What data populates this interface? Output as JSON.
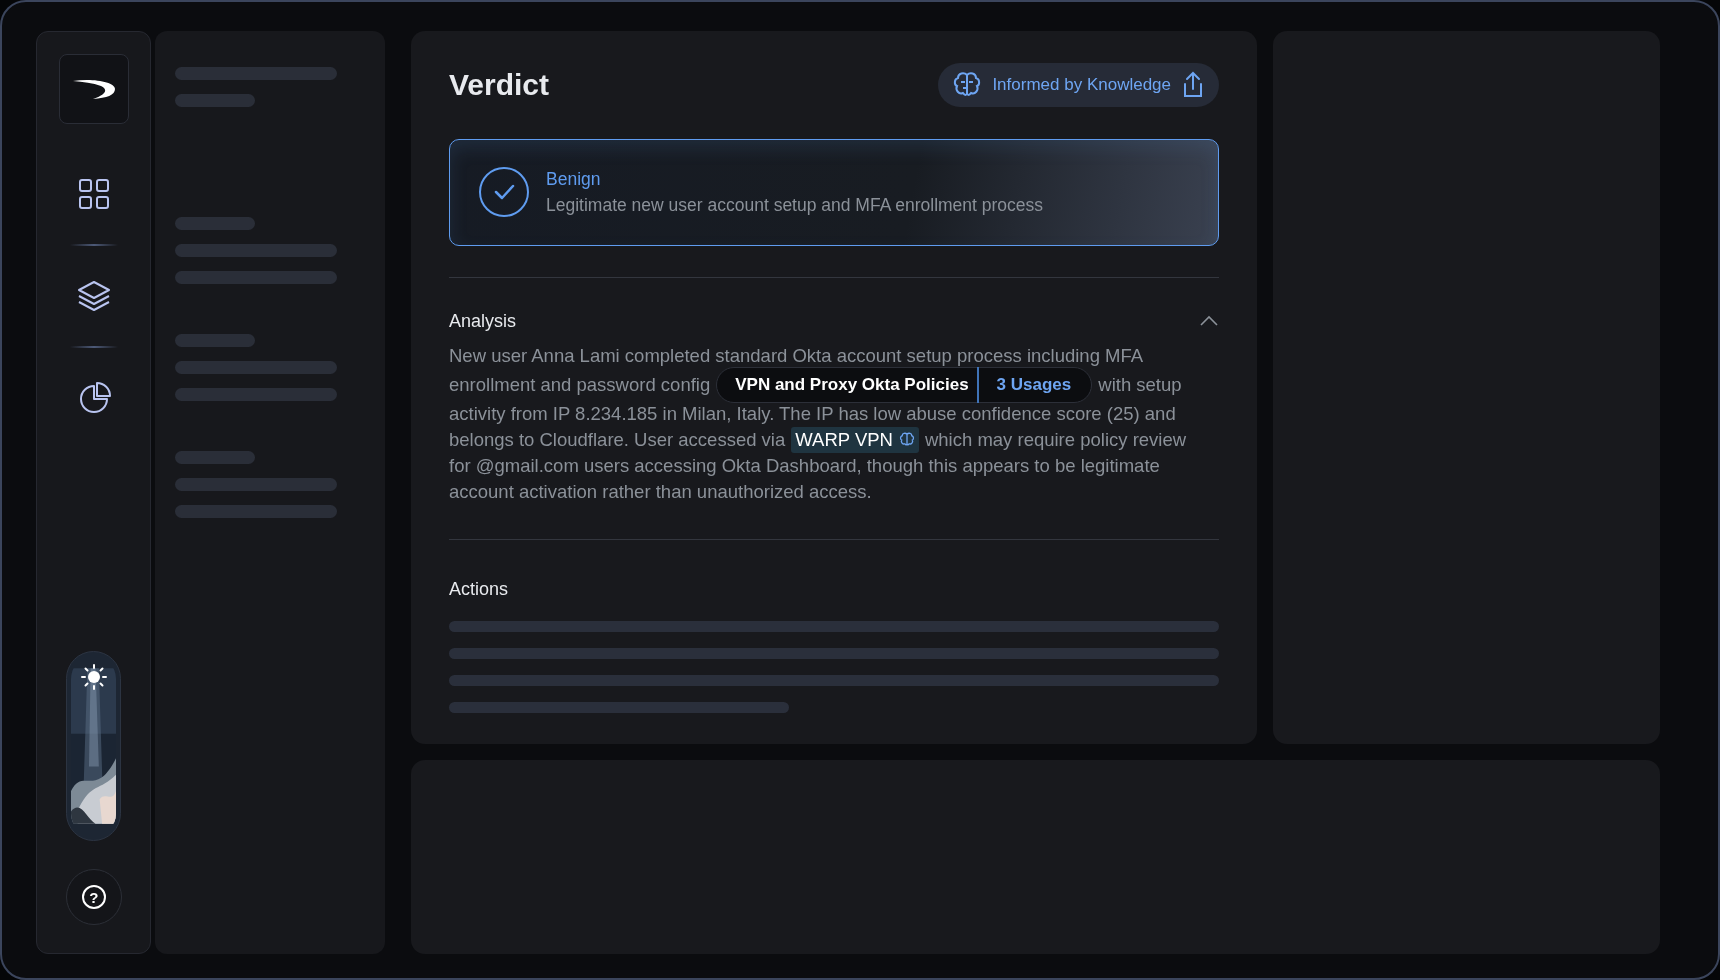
{
  "nav": [
    {
      "kind": "grid"
    },
    {
      "kind": "layers"
    },
    {
      "kind": "chart"
    }
  ],
  "help_button": {
    "label": "?"
  },
  "verdict": {
    "title": "Verdict",
    "knowledge_badge": "Informed by Knowledge",
    "result": {
      "kind": "benign",
      "label": "Benign",
      "description": "Legitimate new user account setup and MFA enrollment process"
    }
  },
  "analysis": {
    "title": "Analysis",
    "expanded": true,
    "lines": [
      [
        {
          "kind": "text",
          "text": "New user Anna Lami completed standard Okta account setup process including MFA"
        }
      ],
      [
        {
          "kind": "text",
          "text": "enrollment and password config"
        },
        {
          "kind": "tooltip",
          "title": "VPN and Proxy Okta Policies",
          "count": "3 Usages"
        },
        {
          "kind": "text",
          "text": "with setup"
        }
      ],
      [
        {
          "kind": "text",
          "text": "activity from IP 8.234.185 in Milan, Italy. The IP has low abuse confidence score (25) and"
        }
      ],
      [
        {
          "kind": "text",
          "text": "belongs to Cloudflare. User accessed via"
        },
        {
          "kind": "entity",
          "text": "WARP VPN"
        },
        {
          "kind": "text",
          "text": "which may require policy review"
        }
      ],
      [
        {
          "kind": "text",
          "text": "for @gmail.com users accessing Okta Dashboard, though this appears to be legitimate"
        }
      ],
      [
        {
          "kind": "text",
          "text": "account activation rather than unauthorized access."
        }
      ]
    ]
  },
  "actions": {
    "title": "Actions"
  }
}
